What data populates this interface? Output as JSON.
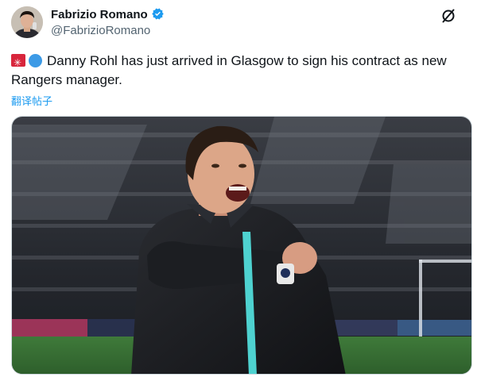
{
  "tweet": {
    "author": {
      "display_name": "Fabrizio Romano",
      "handle": "@FabrizioRomano",
      "verified": true,
      "avatar_icon": "profile-photo"
    },
    "emojis": [
      "flag-icon",
      "blue-circle-icon"
    ],
    "text": "Danny Rohl has just arrived in Glasgow to sign his contract as new Rangers manager.",
    "translate_label": "翻译帖子",
    "top_right_icon": "grok-icon",
    "media": {
      "type": "photo",
      "icon": "photo-manager-celebrating"
    }
  },
  "colors": {
    "link": "#1d9bf0",
    "verified": "#1d9bf0",
    "text": "#0f1419",
    "secondary": "#536471"
  }
}
